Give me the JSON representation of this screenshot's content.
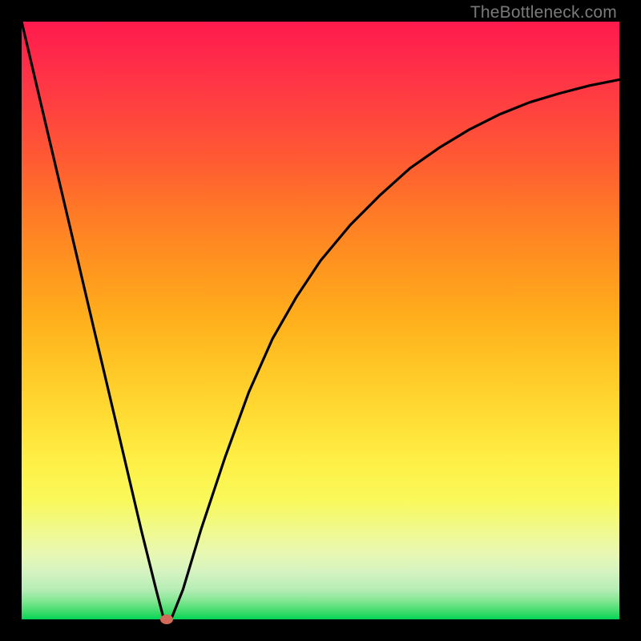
{
  "watermark": "TheBottleneck.com",
  "colors": {
    "frame": "#000000",
    "curve": "#000000",
    "dot": "#d46a5a"
  },
  "chart_data": {
    "type": "line",
    "title": "",
    "xlabel": "",
    "ylabel": "",
    "xlim": [
      0,
      100
    ],
    "ylim": [
      0,
      100
    ],
    "grid": false,
    "series": [
      {
        "name": "bottleneck-curve",
        "x": [
          0,
          4,
          8,
          12,
          16,
          20,
          22.5,
          23.8,
          25,
          27,
          30,
          34,
          38,
          42,
          46,
          50,
          55,
          60,
          65,
          70,
          75,
          80,
          85,
          90,
          95,
          100
        ],
        "y": [
          100,
          83,
          66,
          49,
          32,
          15,
          5,
          0,
          0,
          5,
          15,
          27,
          38,
          47,
          54,
          60,
          66,
          71,
          75.5,
          79,
          82,
          84.5,
          86.5,
          88,
          89.3,
          90.3
        ]
      }
    ],
    "annotations": [
      {
        "name": "bottleneck-point",
        "x": 24.3,
        "y": 0
      }
    ]
  }
}
